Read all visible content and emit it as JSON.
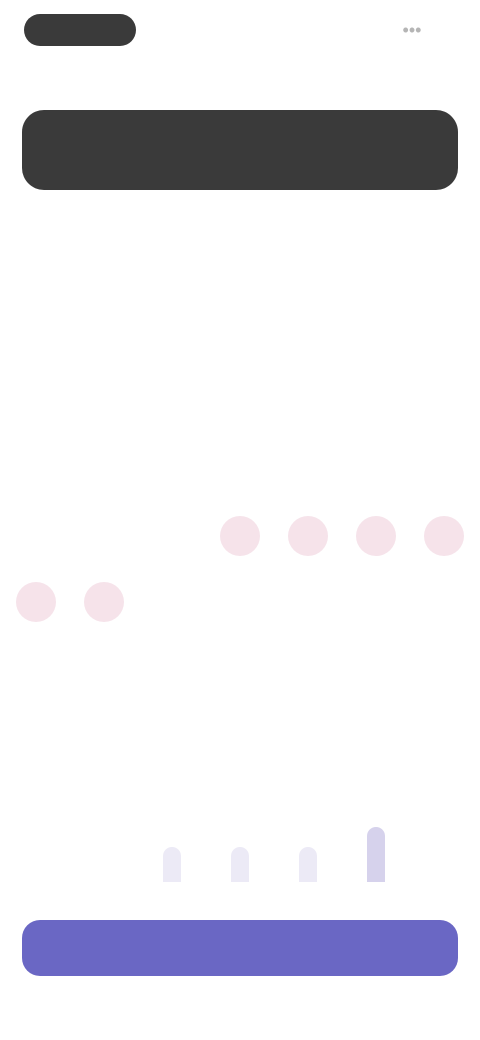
{
  "header": {
    "back_label": "",
    "menu_label": "•••"
  },
  "summary": {
    "label": ""
  },
  "weekdays": [
    "",
    "",
    "",
    "",
    "",
    "",
    ""
  ],
  "calendar": {
    "month_title": "",
    "cells": [
      {
        "day": "",
        "sel": false
      },
      {
        "day": "",
        "sel": false
      },
      {
        "day": "",
        "sel": false
      },
      {
        "day": "",
        "sel": false
      },
      {
        "day": "",
        "sel": false
      },
      {
        "day": "",
        "sel": false
      },
      {
        "day": "",
        "sel": false
      },
      {
        "day": "",
        "sel": false
      },
      {
        "day": "",
        "sel": false
      },
      {
        "day": "",
        "sel": false
      },
      {
        "day": "",
        "sel": false
      },
      {
        "day": "",
        "sel": false
      },
      {
        "day": "",
        "sel": false
      },
      {
        "day": "",
        "sel": false
      },
      {
        "day": "",
        "sel": false
      },
      {
        "day": "",
        "sel": false
      },
      {
        "day": "",
        "sel": false
      },
      {
        "day": "",
        "sel": true
      },
      {
        "day": "",
        "sel": true
      },
      {
        "day": "",
        "sel": true
      },
      {
        "day": "",
        "sel": true
      },
      {
        "day": "",
        "sel": true
      },
      {
        "day": "",
        "sel": true
      },
      {
        "day": "",
        "sel": false
      },
      {
        "day": "",
        "sel": false
      },
      {
        "day": "",
        "sel": false
      },
      {
        "day": "",
        "sel": false
      },
      {
        "day": "",
        "sel": false
      },
      {
        "day": "",
        "sel": false
      },
      {
        "day": "",
        "sel": false
      },
      {
        "day": "",
        "sel": false
      },
      {
        "day": "",
        "sel": false
      },
      {
        "day": "",
        "sel": false
      },
      {
        "day": "",
        "sel": false
      },
      {
        "day": "",
        "sel": false
      },
      {
        "day": "",
        "sel": false
      },
      {
        "day": "",
        "sel": false
      }
    ]
  },
  "timeline": {
    "section_title": "",
    "levels": [
      0,
      0,
      0.35,
      0.35,
      0.35,
      0.55,
      0
    ],
    "highlighted_index": 5,
    "value_labels": [
      "",
      "",
      "",
      "",
      "",
      "",
      ""
    ],
    "day_labels": [
      "",
      "",
      "",
      "",
      "",
      "",
      ""
    ]
  },
  "cta": {
    "label": ""
  },
  "colors": {
    "accent": "#6a67c4",
    "selected_day": "#f6e3ea",
    "dark_pill": "#3a3a3a"
  }
}
